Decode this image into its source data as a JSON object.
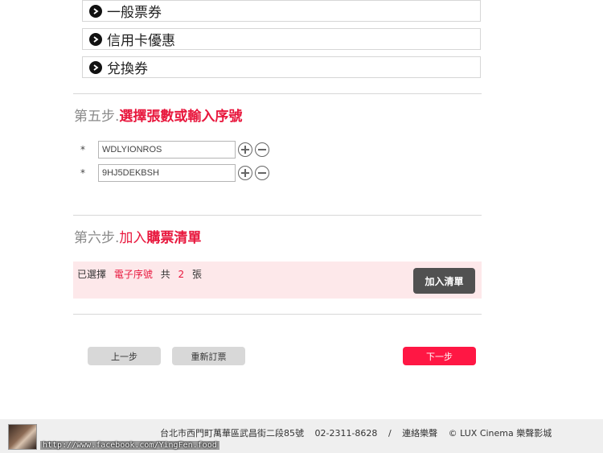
{
  "ticket_options": [
    {
      "label": "一般票券"
    },
    {
      "label": "信用卡優惠"
    },
    {
      "label": "兌換券"
    }
  ],
  "step5": {
    "prefix": "第五步.",
    "title": "選擇張數或輸入序號"
  },
  "codes": [
    {
      "star": "*",
      "value": "WDLYIONROS"
    },
    {
      "star": "*",
      "value": "9HJ5DEKBSH"
    }
  ],
  "step6": {
    "prefix": "第六步.",
    "title_a": "加入",
    "title_b": "購票清單"
  },
  "summary": {
    "selected_label": "已選擇",
    "type": "電子序號",
    "total_label": "共",
    "count": "2",
    "unit": "張",
    "add_button": "加入清單"
  },
  "nav": {
    "prev": "上一步",
    "reset": "重新訂票",
    "next": "下一步"
  },
  "footer": {
    "address": "台北市西門町萬華區武昌街二段85號",
    "phone": "02-2311-8628",
    "sep": "/",
    "contact": "連絡樂聲",
    "copyright": "© LUX Cinema 樂聲影城",
    "watermark": "http://www.facebook.com/YingFen.food"
  }
}
